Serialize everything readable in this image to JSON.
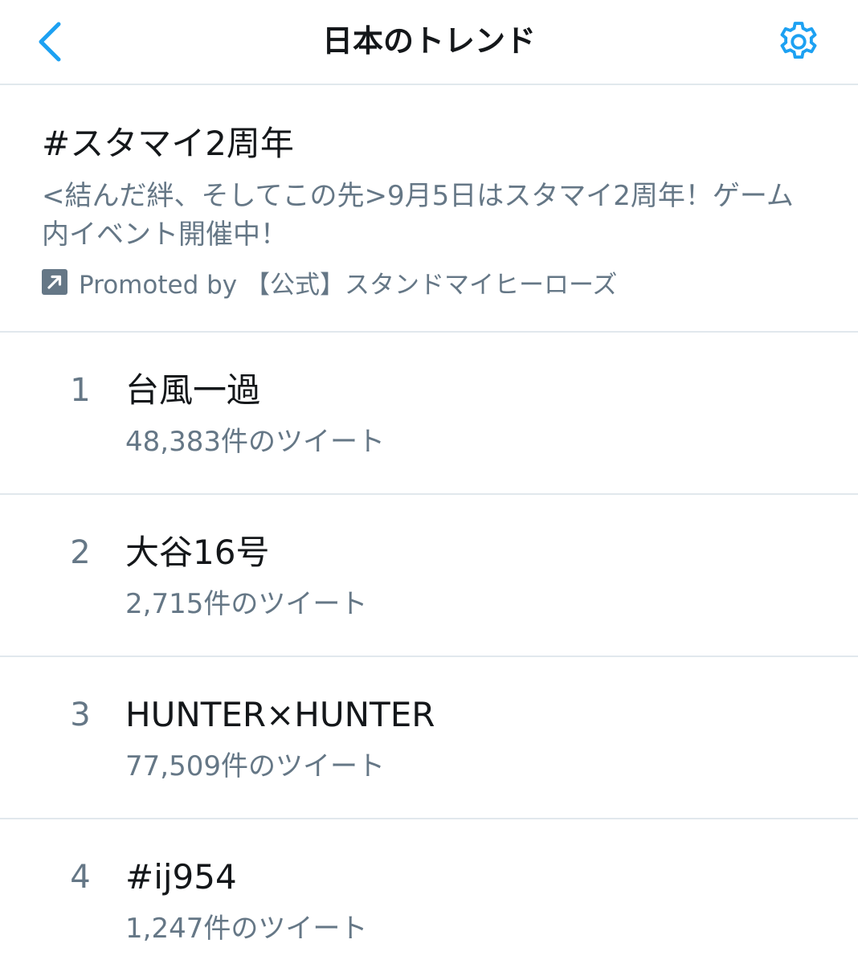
{
  "header": {
    "title": "日本のトレンド",
    "back_icon": "chevron-left-icon",
    "settings_icon": "gear-icon"
  },
  "promoted": {
    "title": "#スタマイ2周年",
    "description": "<結んだ絆、そしてこの先>9月5日はスタマイ2周年！ゲーム内イベント開催中！",
    "promoted_by": "Promoted by 【公式】スタンドマイヒーローズ",
    "icon": "promoted-arrow-icon"
  },
  "trends": [
    {
      "rank": "1",
      "name": "台風一過",
      "count": "48,383件のツイート"
    },
    {
      "rank": "2",
      "name": "大谷16号",
      "count": "2,715件のツイート"
    },
    {
      "rank": "3",
      "name": "HUNTER×HUNTER",
      "count": "77,509件のツイート"
    },
    {
      "rank": "4",
      "name": "#ij954",
      "count": "1,247件のツイート"
    }
  ],
  "colors": {
    "accent": "#1da1f2",
    "text_primary": "#14171a",
    "text_secondary": "#657786",
    "divider": "#e1e8ed",
    "promo_icon_bg": "#657786"
  }
}
